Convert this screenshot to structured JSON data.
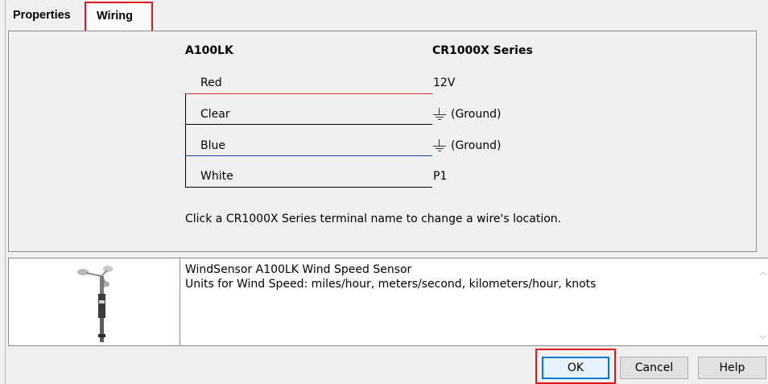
{
  "tabs": [
    {
      "label": "Properties",
      "active": false
    },
    {
      "label": "Wiring",
      "active": true
    }
  ],
  "wiring": {
    "sensor_header": "A100LK",
    "logger_header": "CR1000X Series",
    "wires": [
      {
        "label": "Red",
        "terminal": "12V",
        "color": "#d9262b",
        "ground": false
      },
      {
        "label": "Clear",
        "terminal": "(Ground)",
        "color": "#000000",
        "ground": true
      },
      {
        "label": "Blue",
        "terminal": "(Ground)",
        "color": "#2b3ba8",
        "ground": true
      },
      {
        "label": "White",
        "terminal": "P1",
        "color": "#000000",
        "ground": false
      }
    ],
    "hint": "Click a CR1000X Series terminal name to change a wire's location."
  },
  "info": {
    "line1": "WindSensor A100LK Wind Speed Sensor",
    "line2": "Units for Wind Speed: miles/hour, meters/second, kilometers/hour, knots"
  },
  "buttons": {
    "ok": "OK",
    "cancel": "Cancel",
    "help": "Help"
  },
  "icons": {
    "ground": "ground-symbol-icon",
    "sensor": "anemometer-icon",
    "scroll_up": "chevron-up-icon",
    "scroll_down": "chevron-down-icon"
  },
  "colors": {
    "highlight": "#e0191d",
    "focus": "#0078d7"
  }
}
